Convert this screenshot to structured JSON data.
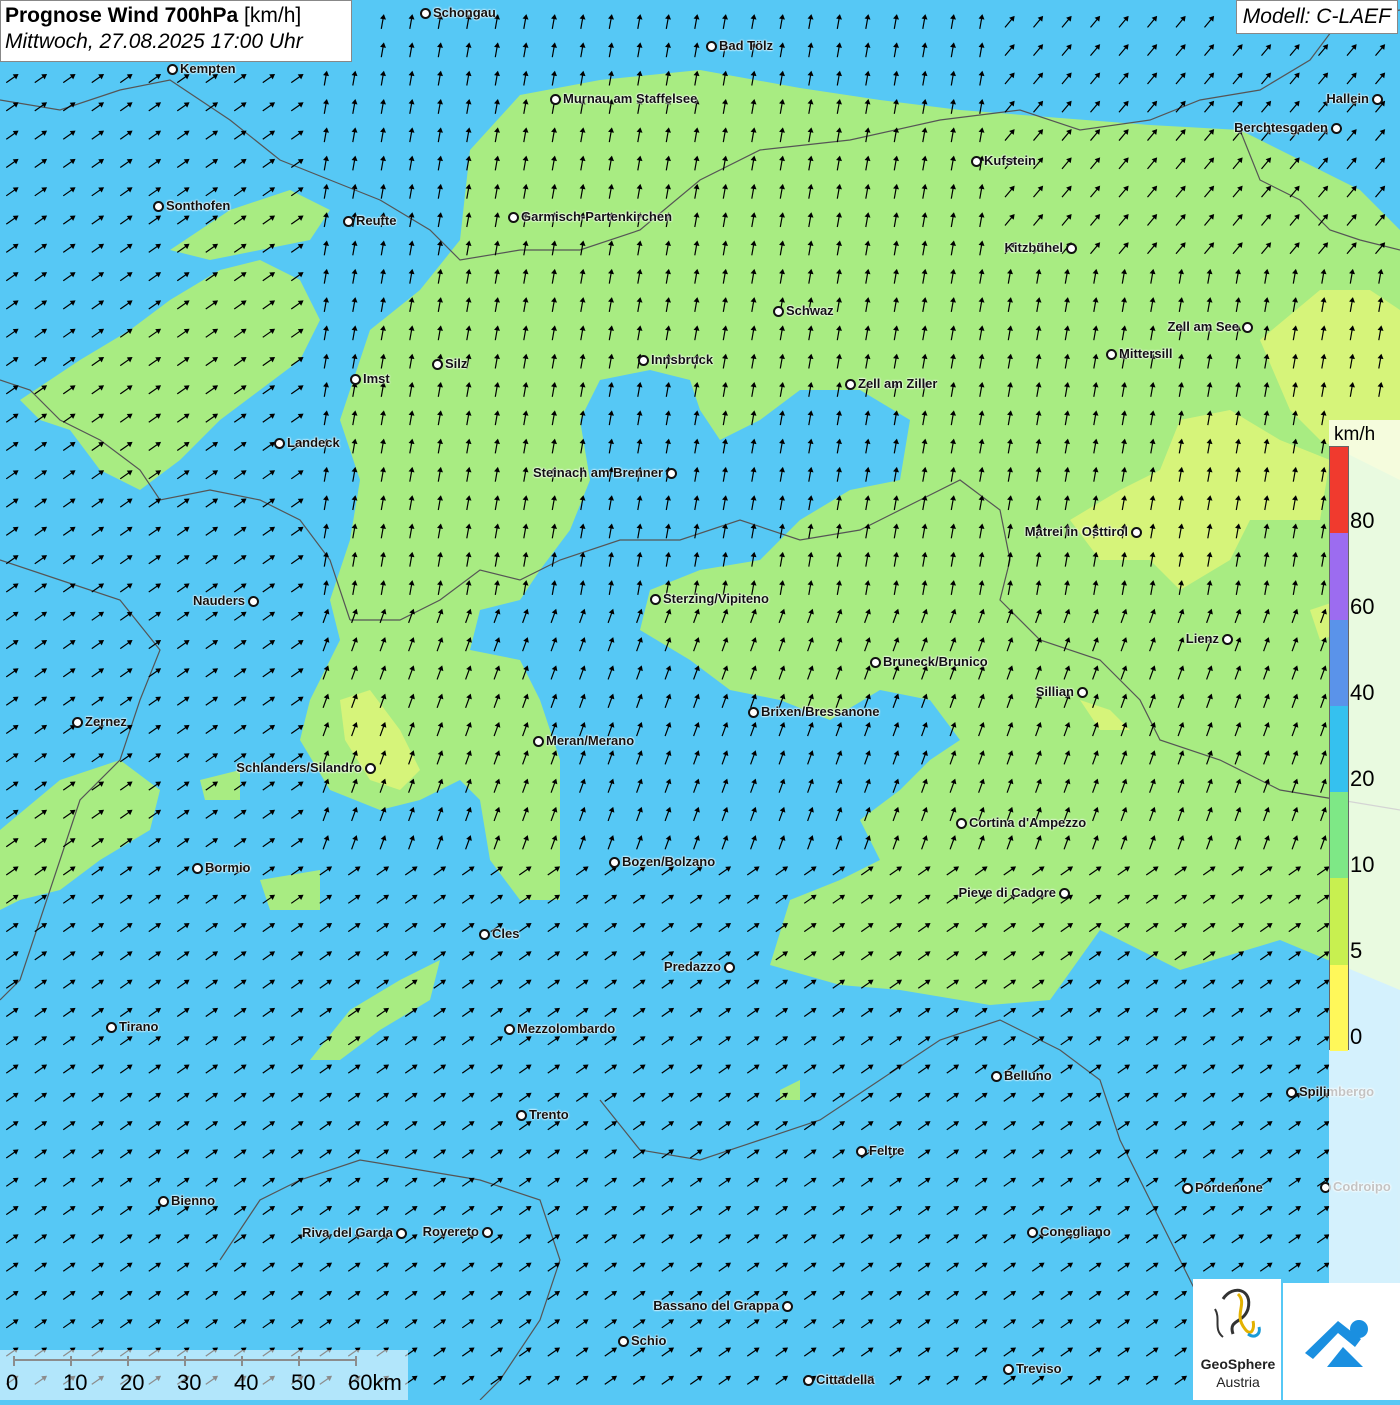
{
  "header": {
    "title_bold": "Prognose Wind 700hPa",
    "title_unit": "[km/h]",
    "datetime": "Mittwoch, 27.08.2025 17:00 Uhr",
    "model": "Modell: C-LAEF"
  },
  "legend": {
    "unit": "km/h",
    "ticks": [
      "80",
      "60",
      "40",
      "20",
      "10",
      "5",
      "0"
    ],
    "colors": [
      "#f03a2e",
      "#9c6cf0",
      "#5a93ea",
      "#35c1ef",
      "#7ee886",
      "#c8f050",
      "#fff85a"
    ]
  },
  "scale": {
    "labels": [
      "0",
      "10",
      "20",
      "30",
      "40",
      "50",
      "60km"
    ]
  },
  "wind": {
    "direction": "from south-southwest",
    "arrow_color": "#000000"
  },
  "colors": {
    "calm_band": "#a8ec82",
    "breeze_band": "#56c8f5",
    "border": "#555555"
  },
  "cities": [
    {
      "name": "Schongau"
    },
    {
      "name": "Bad Tölz"
    },
    {
      "name": "Kempten"
    },
    {
      "name": "Murnau am Staffelsee"
    },
    {
      "name": "Hallein"
    },
    {
      "name": "Berchtesgaden"
    },
    {
      "name": "Kufstein"
    },
    {
      "name": "Sonthofen"
    },
    {
      "name": "Reutte"
    },
    {
      "name": "Garmisch-Partenkirchen"
    },
    {
      "name": "Kitzbühel"
    },
    {
      "name": "Schwaz"
    },
    {
      "name": "Zell am See"
    },
    {
      "name": "Mittersill"
    },
    {
      "name": "Innsbruck"
    },
    {
      "name": "Silz"
    },
    {
      "name": "Imst"
    },
    {
      "name": "Zell am Ziller"
    },
    {
      "name": "Landeck"
    },
    {
      "name": "Steinach am Brenner"
    },
    {
      "name": "Matrei in Osttirol"
    },
    {
      "name": "Nauders"
    },
    {
      "name": "Sterzing/Vipiteno"
    },
    {
      "name": "Lienz"
    },
    {
      "name": "Bruneck/Brunico"
    },
    {
      "name": "Sillian"
    },
    {
      "name": "Brixen/Bressanone"
    },
    {
      "name": "Zernez"
    },
    {
      "name": "Meran/Merano"
    },
    {
      "name": "Schlanders/Silandro"
    },
    {
      "name": "Cortina d'Ampezzo"
    },
    {
      "name": "Bozen/Bolzano"
    },
    {
      "name": "Bormio"
    },
    {
      "name": "Pieve di Cadore"
    },
    {
      "name": "Cles"
    },
    {
      "name": "Predazzo"
    },
    {
      "name": "Tirano"
    },
    {
      "name": "Mezzolombardo"
    },
    {
      "name": "Belluno"
    },
    {
      "name": "Spilimbergo"
    },
    {
      "name": "Trento"
    },
    {
      "name": "Feltre"
    },
    {
      "name": "Pordenone"
    },
    {
      "name": "Codroipo"
    },
    {
      "name": "Bienno"
    },
    {
      "name": "Riva del Garda"
    },
    {
      "name": "Rovereto"
    },
    {
      "name": "Conegliano"
    },
    {
      "name": "Bassano del Grappa"
    },
    {
      "name": "Schio"
    },
    {
      "name": "Treviso"
    },
    {
      "name": "Cittadella"
    }
  ],
  "logos": {
    "org_line1": "GeoSphere",
    "org_line2": "Austria"
  }
}
